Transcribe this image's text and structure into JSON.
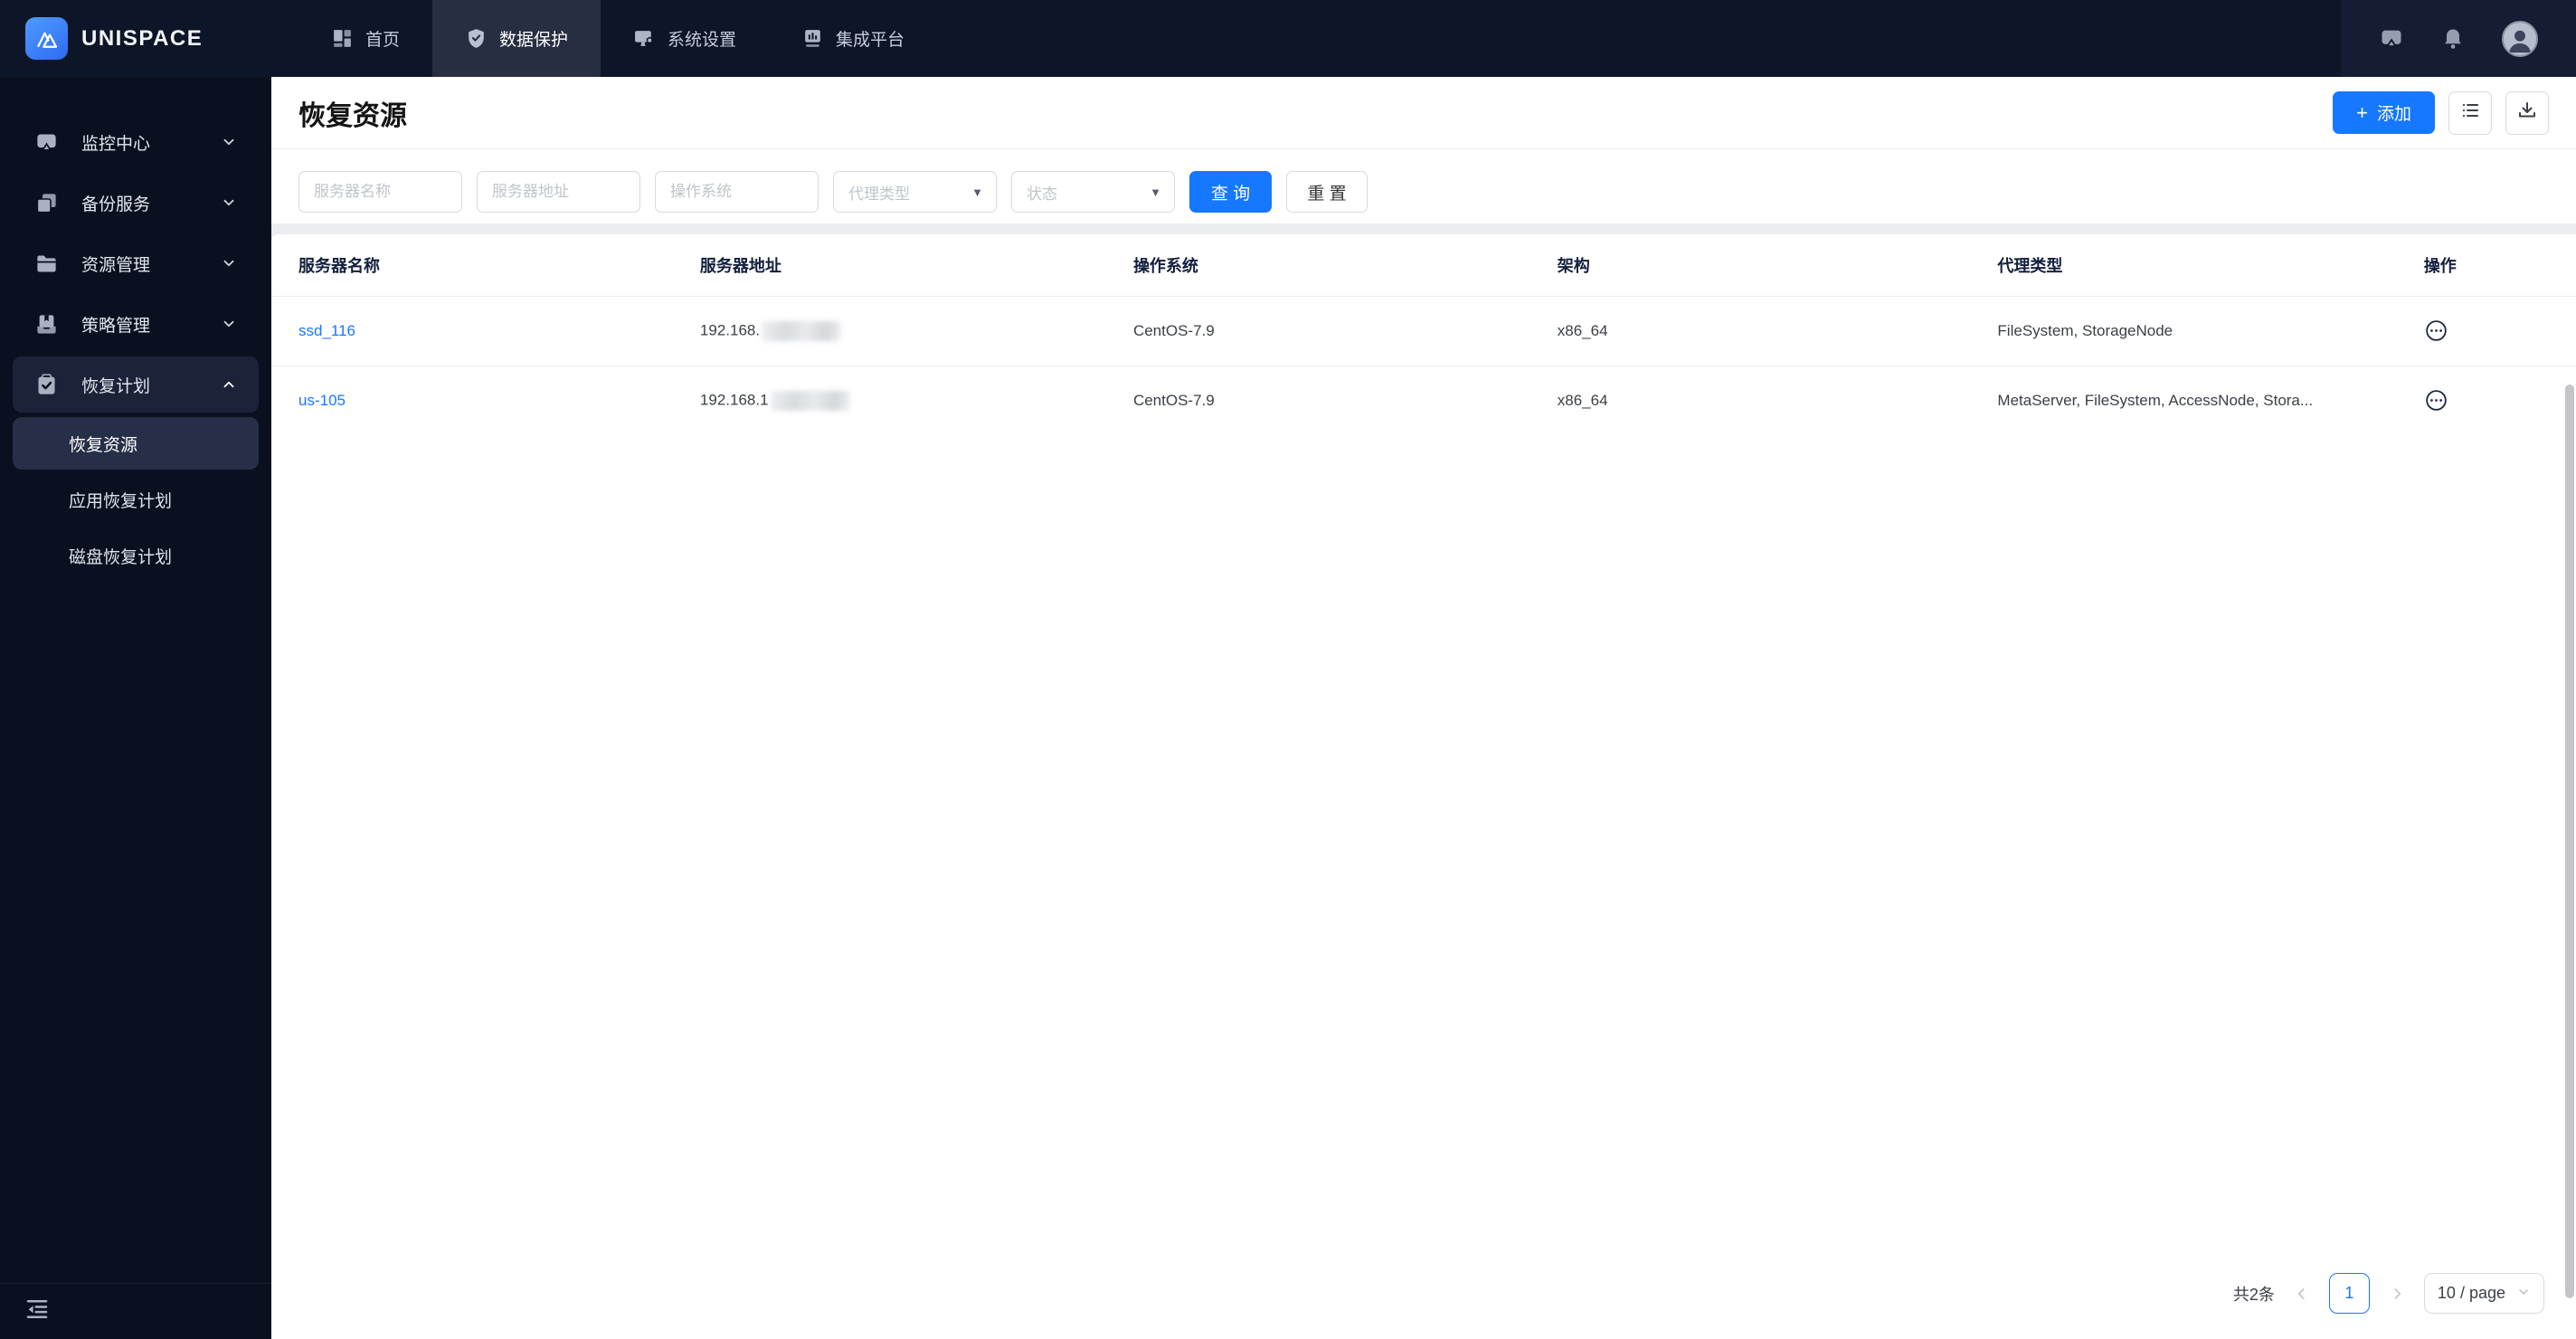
{
  "brand": "UNISPACE",
  "topnav": {
    "items": [
      {
        "label": "首页"
      },
      {
        "label": "数据保护"
      },
      {
        "label": "系统设置"
      },
      {
        "label": "集成平台"
      }
    ]
  },
  "sidebar": {
    "items": [
      {
        "label": "监控中心"
      },
      {
        "label": "备份服务"
      },
      {
        "label": "资源管理"
      },
      {
        "label": "策略管理"
      },
      {
        "label": "恢复计划"
      }
    ],
    "recovery_children": [
      {
        "label": "恢复资源"
      },
      {
        "label": "应用恢复计划"
      },
      {
        "label": "磁盘恢复计划"
      }
    ]
  },
  "page": {
    "title": "恢复资源",
    "add_button": {
      "icon": "+",
      "label": "添加"
    }
  },
  "filters": {
    "server_name_placeholder": "服务器名称",
    "server_address_placeholder": "服务器地址",
    "os_placeholder": "操作系统",
    "agent_type_placeholder": "代理类型",
    "status_placeholder": "状态",
    "search_label": "查 询",
    "reset_label": "重 置"
  },
  "table": {
    "columns": [
      "服务器名称",
      "服务器地址",
      "操作系统",
      "架构",
      "代理类型",
      "操作"
    ],
    "rows": [
      {
        "name": "ssd_116",
        "address_prefix": "192.168.",
        "os": "CentOS-7.9",
        "arch": "x86_64",
        "agent_types": "FileSystem, StorageNode"
      },
      {
        "name": "us-105",
        "address_prefix": "192.168.1",
        "os": "CentOS-7.9",
        "arch": "x86_64",
        "agent_types": "MetaServer, FileSystem, AccessNode, Stora..."
      }
    ]
  },
  "pagination": {
    "total": "共2条",
    "current_page": "1",
    "page_size": "10 / page"
  },
  "colors": {
    "accent": "#1677ff",
    "topbar_bg": "#0d1528",
    "sidebar_bg": "#0a101f",
    "link": "#1677ff"
  }
}
